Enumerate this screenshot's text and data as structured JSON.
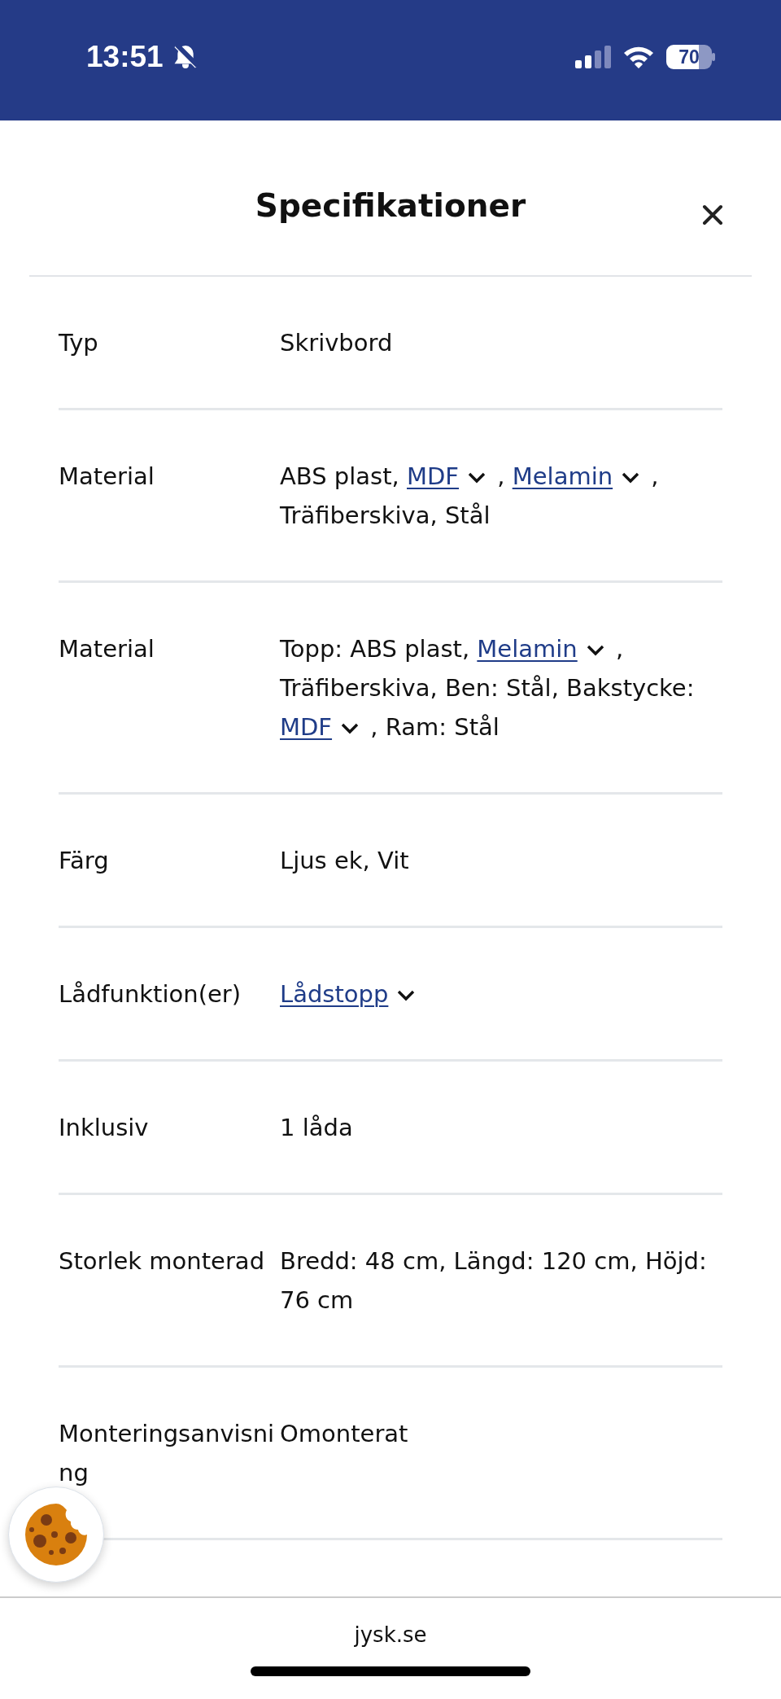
{
  "status_bar": {
    "time": "13:51",
    "battery": "70"
  },
  "title": "Specifikationer",
  "specs": [
    {
      "label": "Typ",
      "value": [
        {
          "kind": "text",
          "text": "Skrivbord"
        }
      ]
    },
    {
      "label": "Material",
      "value": [
        {
          "kind": "text",
          "text": "ABS plast, "
        },
        {
          "kind": "link",
          "text": "MDF"
        },
        {
          "kind": "text",
          "text": " , "
        },
        {
          "kind": "link",
          "text": "Melamin"
        },
        {
          "kind": "text",
          "text": " , Träfiberskiva, Stål"
        }
      ]
    },
    {
      "label": "Material",
      "value": [
        {
          "kind": "text",
          "text": "Topp: ABS plast, "
        },
        {
          "kind": "link",
          "text": "Melamin"
        },
        {
          "kind": "text",
          "text": " , Träfiberskiva, Ben: Stål, Bakstycke: "
        },
        {
          "kind": "link",
          "text": "MDF"
        },
        {
          "kind": "text",
          "text": " , Ram: Stål"
        }
      ]
    },
    {
      "label": "Färg",
      "value": [
        {
          "kind": "text",
          "text": "Ljus ek, Vit"
        }
      ]
    },
    {
      "label": "Lådfunktion(er)",
      "value": [
        {
          "kind": "link",
          "text": "Lådstopp"
        }
      ]
    },
    {
      "label": "Inklusiv",
      "value": [
        {
          "kind": "text",
          "text": "1 låda"
        }
      ]
    },
    {
      "label": "Storlek monterad",
      "value": [
        {
          "kind": "text",
          "text": "Bredd: 48 cm, Längd: 120 cm, Höjd: 76 cm"
        }
      ]
    },
    {
      "label": "Monteringsanvisning",
      "value": [
        {
          "kind": "text",
          "text": "Omonterat"
        }
      ]
    }
  ],
  "footer": {
    "url": "jysk.se"
  }
}
